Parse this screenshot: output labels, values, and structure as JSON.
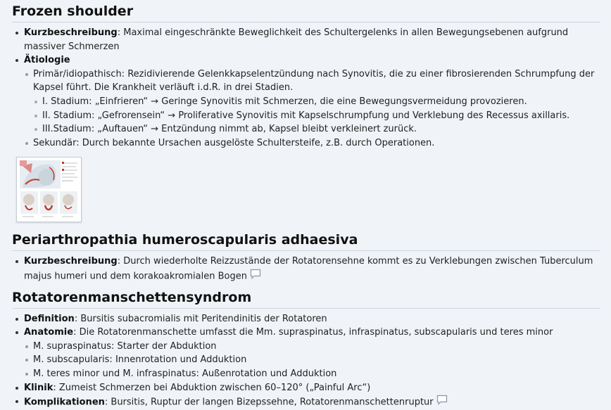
{
  "sections": [
    {
      "title": "Frozen shoulder",
      "kurz_label": "Kurzbeschreibung",
      "kurz_text": ": Maximal eingeschränkte Beweglichkeit des Schultergelenks in allen Bewegungsebenen aufgrund massiver Schmerzen",
      "aetiologie_label": "Ätiologie",
      "primaer_text": "Primär/idiopathisch: Rezidivierende Gelenkkapselentzündung nach Synovitis, die zu einer fibrosierenden Schrumpfung der Kapsel führt. Die Krankheit verläuft i.d.R. in drei Stadien.",
      "stadien": [
        "I. Stadium: „Einfrieren“ → Geringe Synovitis mit Schmerzen, die eine Bewegungsvermeidung provozieren.",
        "II. Stadium: „Gefrorensein“ → Proliferative Synovitis mit Kapselschrumpfung und Verklebung des Recessus axillaris.",
        "III.Stadium: „Auftauen“ → Entzündung nimmt ab, Kapsel bleibt verkleinert zurück."
      ],
      "sekundaer_text": "Sekundär: Durch bekannte Ursachen ausgelöste Schultersteife, z.B. durch Operationen."
    },
    {
      "title": "Periarthropathia humeroscapularis adhaesiva",
      "kurz_label": "Kurzbeschreibung",
      "kurz_text": ": Durch wiederholte Reizzustände der Rotatorensehne kommt es zu Verklebungen zwischen Tuberculum majus humeri und dem korakoakromialen Bogen"
    },
    {
      "title": "Rotatorenmanschettensyndrom",
      "definition_label": "Definition",
      "definition_text": ": Bursitis subacromialis mit Peritendinitis der Rotatoren",
      "anatomie_label": "Anatomie",
      "anatomie_text": ": Die Rotatorenmanschette umfasst die Mm. supraspinatus, infraspinatus, subscapularis und teres minor",
      "muskeln": [
        "M. supraspinatus: Starter der Abduktion",
        "M. subscapularis: Innenrotation und Adduktion",
        "M. teres minor und M. infraspinatus: Außenrotation und Adduktion"
      ],
      "klinik_label": "Klinik",
      "klinik_text": ": Zumeist Schmerzen bei Abduktion zwischen 60–120° („Painful Arc“)",
      "komplikationen_label": "Komplikationen",
      "komplikationen_text": ": Bursitis, Ruptur der langen Bizepssehne, Rotatorenmanschettenruptur"
    }
  ],
  "icons": {
    "comment": "comment-icon",
    "thumbnail": "shoulder-illustration-thumbnail"
  },
  "colors": {
    "background": "#f0f3f8",
    "heading_rule": "#cfd6e0",
    "red_accent": "#c0392b"
  }
}
